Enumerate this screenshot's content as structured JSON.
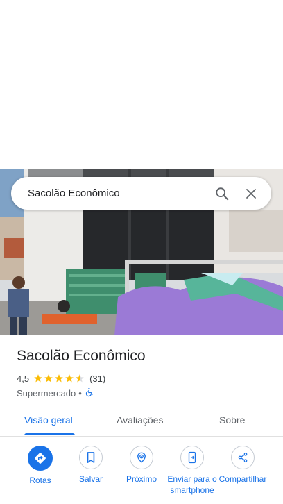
{
  "search": {
    "query": "Sacolão Econômico"
  },
  "place": {
    "name": "Sacolão Econômico",
    "rating": "4,5",
    "rating_value": 4.5,
    "reviews_count": "(31)",
    "category": "Supermercado",
    "separator": "•"
  },
  "tabs": [
    {
      "label": "Visão geral",
      "active": true
    },
    {
      "label": "Avaliações",
      "active": false
    },
    {
      "label": "Sobre",
      "active": false
    }
  ],
  "actions": [
    {
      "label": "Rotas",
      "icon": "directions-icon"
    },
    {
      "label": "Salvar",
      "icon": "bookmark-icon"
    },
    {
      "label": "Próximo",
      "icon": "nearby-icon"
    },
    {
      "label": "Enviar para o smartphone",
      "icon": "send-to-phone-icon"
    },
    {
      "label": "Compartilhar",
      "icon": "share-icon"
    }
  ],
  "colors": {
    "accent": "#1a73e8",
    "star": "#fbbc04",
    "text": "#202124",
    "muted": "#5f6368"
  }
}
